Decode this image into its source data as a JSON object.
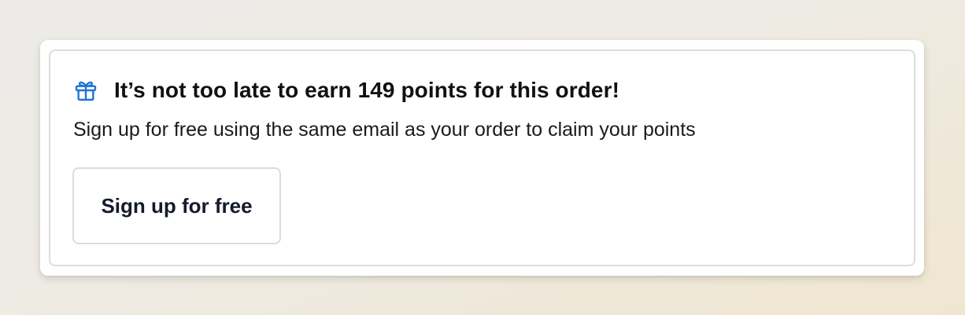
{
  "card": {
    "heading": "It’s not too late to earn 149 points for this order!",
    "subtext": "Sign up for free using the same email as your order to claim your points",
    "button_label": "Sign up for free"
  },
  "icons": {
    "heading_icon": "gift-icon"
  },
  "colors": {
    "accent": "#1f74d6",
    "text": "#111111",
    "button_text": "#151a2d",
    "border": "#dcdcdc"
  }
}
